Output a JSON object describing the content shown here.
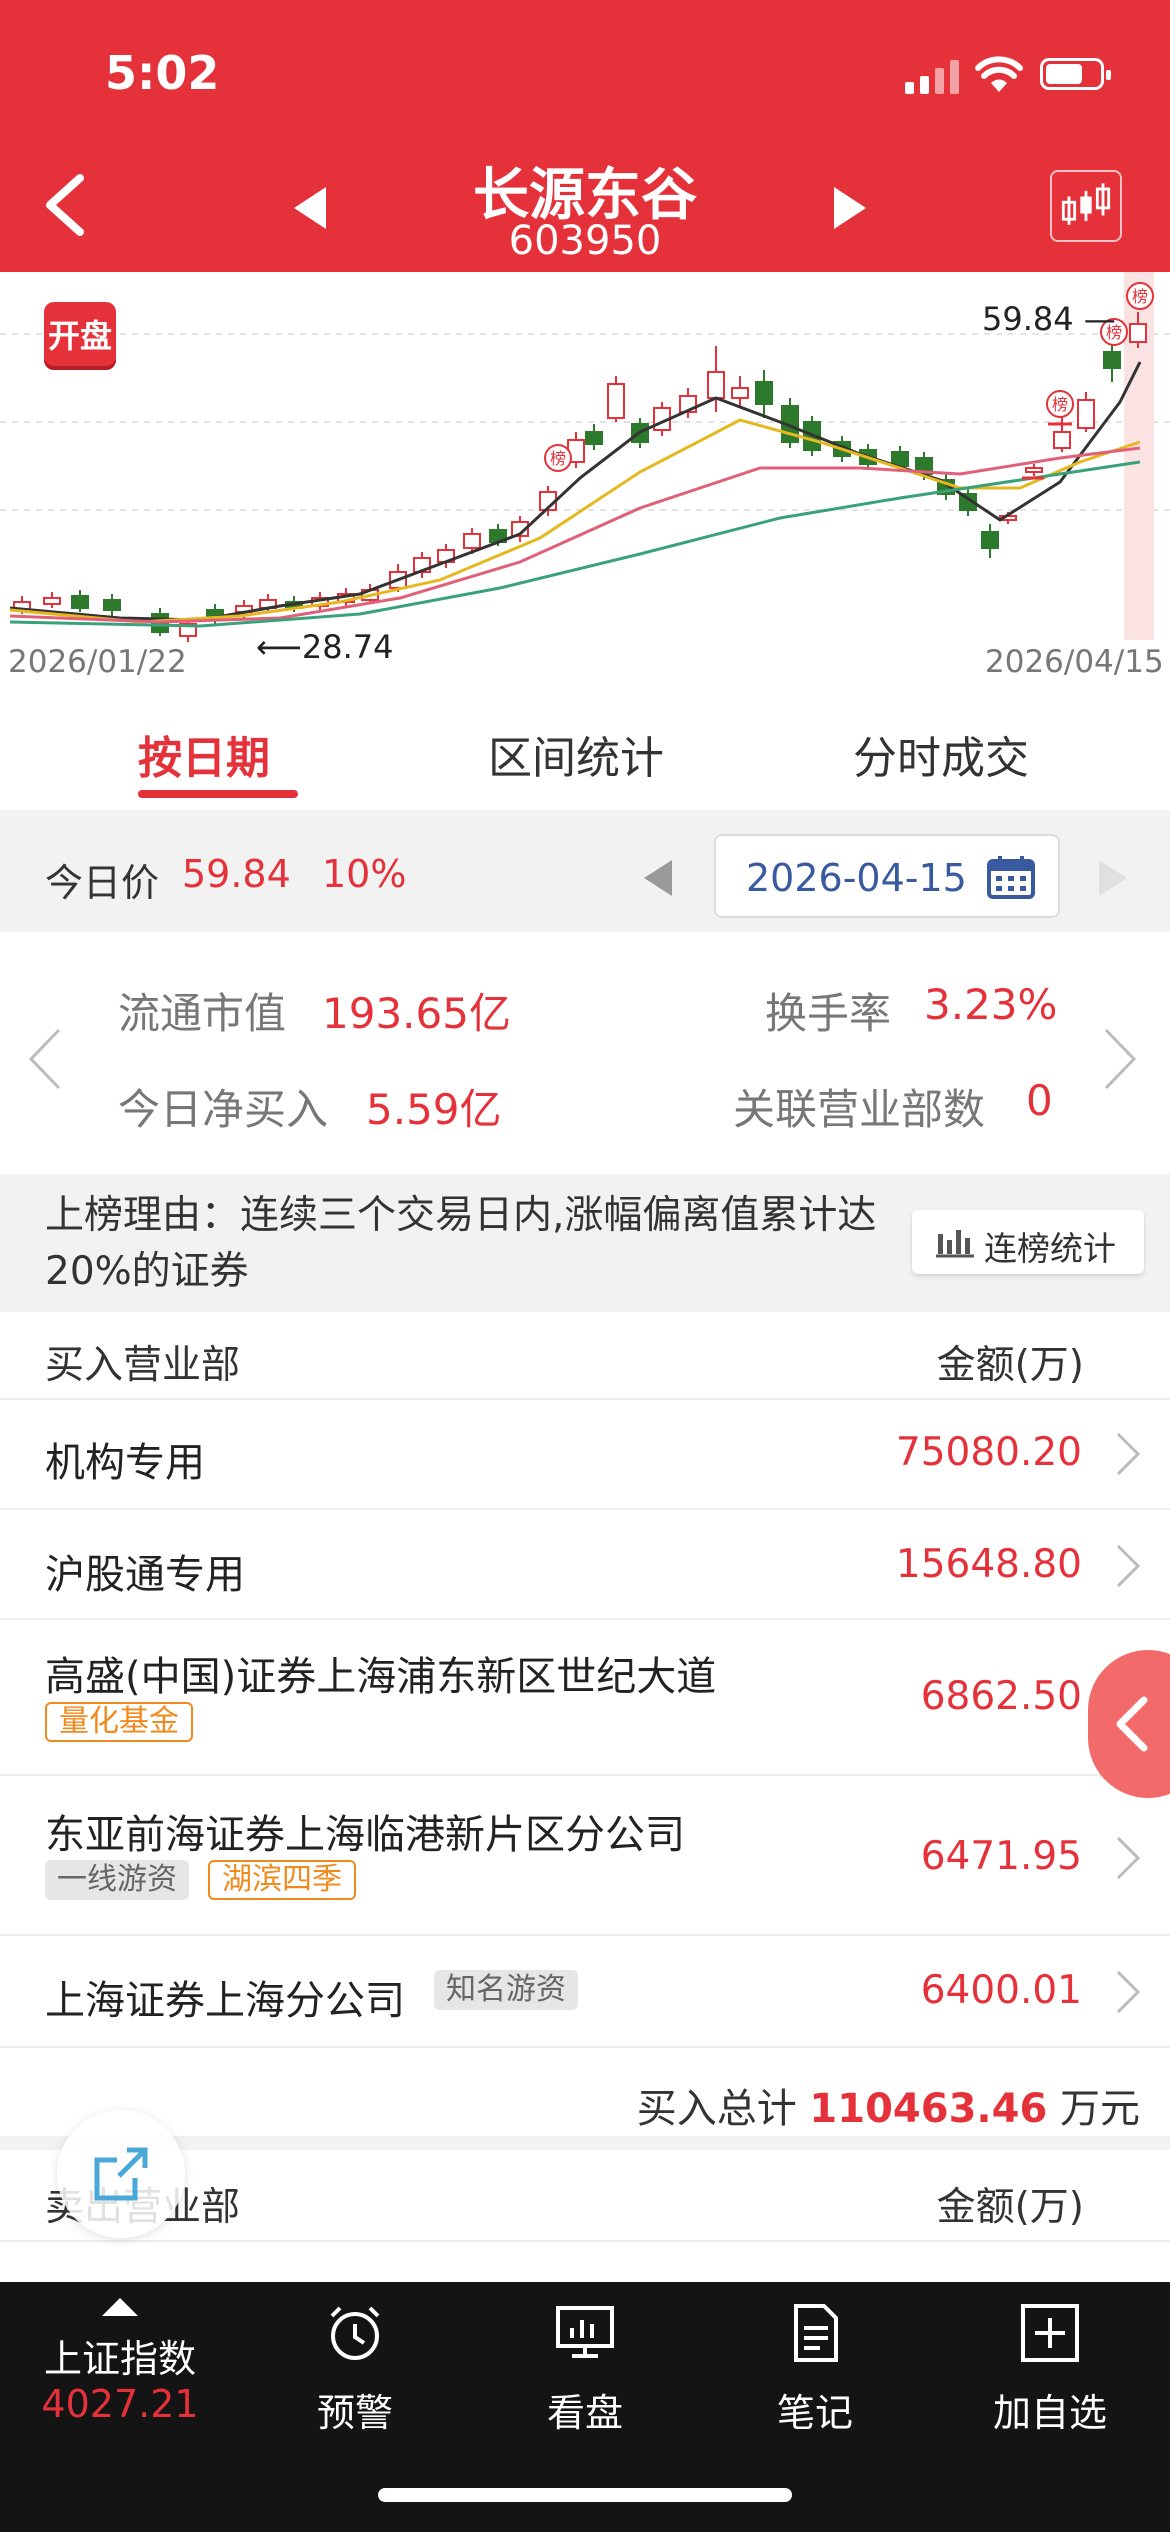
{
  "status_bar": {
    "time": "5:02"
  },
  "header": {
    "stock_name": "长源东谷",
    "stock_code": "603950"
  },
  "chart": {
    "badge": "开盘",
    "start_date": "2026/01/22",
    "end_date": "2026/04/15",
    "low_label": "28.74",
    "high_label": "59.84",
    "rank_marker": "榜",
    "colors": {
      "up": "#e5313a",
      "down": "#2d7a2d",
      "ma5": "#333333",
      "ma10": "#e6b820",
      "ma20": "#e0607a",
      "ma60": "#3aa27a"
    }
  },
  "tabs": [
    {
      "label": "按日期"
    },
    {
      "label": "区间统计"
    },
    {
      "label": "分时成交"
    }
  ],
  "today": {
    "label": "今日价",
    "price": "59.84",
    "change_pct": "10%",
    "date": "2026-04-15"
  },
  "stats": {
    "float_cap_label": "流通市值",
    "float_cap": "193.65亿",
    "turnover_label": "换手率",
    "turnover": "3.23%",
    "net_buy_label": "今日净买入",
    "net_buy": "5.59亿",
    "branches_label": "关联营业部数",
    "branches": "0"
  },
  "reason": {
    "text": "上榜理由：连续三个交易日内,涨幅偏离值累计达20%的证券",
    "rank_button": "连榜统计"
  },
  "buy_table": {
    "header_left": "买入营业部",
    "header_right": "金额(万)",
    "rows": [
      {
        "name": "机构专用",
        "amount": "75080.20",
        "tags": []
      },
      {
        "name": "沪股通专用",
        "amount": "15648.80",
        "tags": []
      },
      {
        "name": "高盛(中国)证券上海浦东新区世纪大道",
        "amount": "6862.50",
        "tags": [
          "量化基金"
        ]
      },
      {
        "name": "东亚前海证券上海临港新片区分公司",
        "amount": "6471.95",
        "tags": [
          "一线游资",
          "湖滨四季"
        ]
      },
      {
        "name": "上海证券上海分公司",
        "amount": "6400.01",
        "tags": [
          "知名游资"
        ]
      }
    ],
    "total_label": "买入总计",
    "total_value": "110463.46",
    "total_unit": "万元"
  },
  "sell_table": {
    "header_left": "卖出营业部",
    "header_right": "金额(万)"
  },
  "bottom_nav": {
    "index_name": "上证指数",
    "index_value": "4027.21",
    "items": [
      {
        "label": "预警",
        "icon": "alarm-clock-icon"
      },
      {
        "label": "看盘",
        "icon": "monitor-chart-icon"
      },
      {
        "label": "笔记",
        "icon": "note-icon"
      },
      {
        "label": "加自选",
        "icon": "add-watchlist-icon"
      }
    ]
  }
}
